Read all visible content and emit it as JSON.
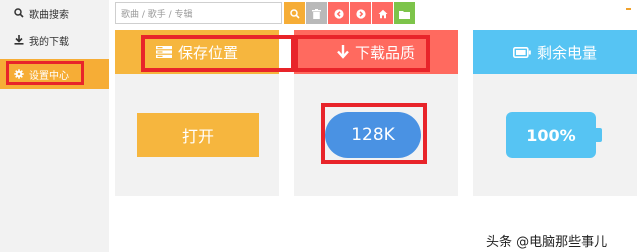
{
  "sidebar": {
    "items": [
      {
        "label": "歌曲搜索",
        "icon": "search-icon",
        "active": false
      },
      {
        "label": "我的下载",
        "icon": "download-icon",
        "active": false
      },
      {
        "label": "设置中心",
        "icon": "gear-icon",
        "active": true
      }
    ]
  },
  "toolbar": {
    "search_placeholder": "歌曲 / 歌手 / 专辑",
    "buttons": [
      "search-icon",
      "trash-icon",
      "chevron-left-icon",
      "chevron-right-icon",
      "home-icon",
      "folder-icon"
    ]
  },
  "cards": {
    "save_location": {
      "title": "保存位置",
      "button": "打开"
    },
    "download_quality": {
      "title": "下载品质",
      "value": "128K"
    },
    "battery": {
      "title": "剩余电量",
      "value": "100%"
    }
  },
  "watermark": "头条 @电脑那些事儿",
  "colors": {
    "orange": "#f6b63e",
    "red": "#ff6a5f",
    "blue": "#56c4f3",
    "quality_blue": "#4a92e3",
    "green": "#7dc44a",
    "highlight": "#e8242a"
  }
}
